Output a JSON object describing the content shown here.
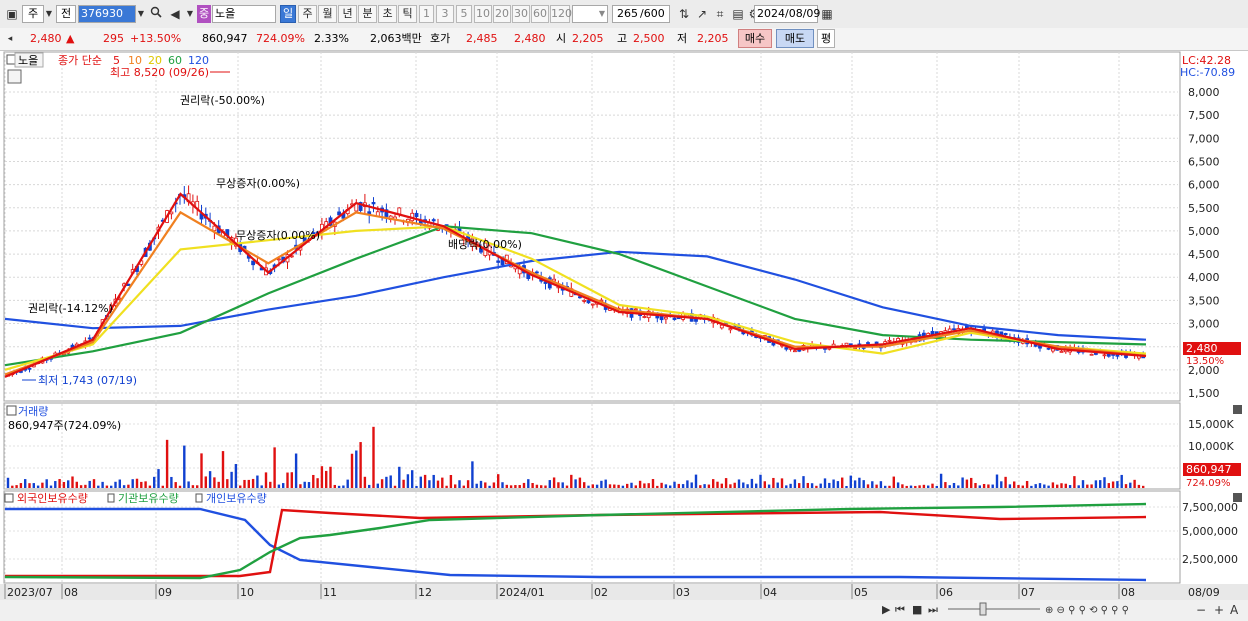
{
  "toolbar": {
    "type_label": "주",
    "period_label": "전",
    "code": "376930",
    "badge": "중",
    "name": "노을",
    "periods": [
      "일",
      "주",
      "월",
      "년",
      "분",
      "초",
      "틱"
    ],
    "ticks": [
      "1",
      "3",
      "5",
      "10",
      "20",
      "30",
      "60",
      "120"
    ],
    "count": "265",
    "count_total": "/600",
    "date": "2024/08/09"
  },
  "quote": {
    "price": "2,480",
    "arrow": "▲",
    "change": "295",
    "change_pct": "+13.50%",
    "volume": "860,947",
    "volume_pct": "724.09%",
    "turnover": "2.33%",
    "amount": "2,063백만",
    "hoga_label": "호가",
    "ask": "2,485",
    "bid": "2,480",
    "open_label": "시",
    "open": "2,205",
    "high_label": "고",
    "high": "2,500",
    "low_label": "저",
    "low": "2,205",
    "buy_label": "매수",
    "sell_label": "매도",
    "eval_label": "평"
  },
  "price_panel": {
    "name_tag": "노을",
    "ma_label": "종가 단순",
    "ma_periods": [
      "5",
      "10",
      "20",
      "60",
      "120"
    ],
    "lc": "LC:42.28",
    "hc": "HC:-70.89",
    "y_ticks": [
      "8,000",
      "7,500",
      "7,000",
      "6,500",
      "6,000",
      "5,500",
      "5,000",
      "4,500",
      "4,000",
      "3,500",
      "3,000",
      "2,500",
      "2,000",
      "1,500"
    ],
    "high_note": "최고 8,520 (09/26)",
    "low_note": "최저 1,743 (07/19)",
    "events": [
      "권리락(-14.12%)",
      "권리락(-50.00%)",
      "무상증자(0.00%)",
      "무상증자(0.00%)",
      "배당락(0.00%)"
    ],
    "last_price": "2,480",
    "last_pct": "13.50%"
  },
  "volume_panel": {
    "title": "거래량",
    "value": "860,947주(724.09%)",
    "y_ticks": [
      "15,000K",
      "10,000K",
      "5,000K"
    ],
    "last": "860,947",
    "last_pct": "724.09%"
  },
  "holdings_panel": {
    "series": [
      "외국인보유수량",
      "기관보유수량",
      "개인보유수량"
    ],
    "y_ticks": [
      "7,500,000",
      "5,000,000",
      "2,500,000"
    ]
  },
  "x_axis": [
    "2023/07",
    "08",
    "09",
    "10",
    "11",
    "12",
    "2024/01",
    "02",
    "03",
    "04",
    "05",
    "06",
    "07",
    "08",
    "08/09"
  ],
  "colors": {
    "ma5": "#e01010",
    "ma10": "#f08020",
    "ma20": "#f0e020",
    "ma60": "#20a040",
    "ma120": "#2050e0",
    "up": "#e01010",
    "down": "#1040d0"
  },
  "chart_data": {
    "type": "line",
    "x": [
      "2023/07",
      "08",
      "09",
      "10",
      "11",
      "12",
      "2024/01",
      "02",
      "03",
      "04",
      "05",
      "06",
      "07",
      "08"
    ],
    "series": [
      {
        "name": "5",
        "values": [
          1850,
          2650,
          5800,
          4100,
          5600,
          5100,
          4050,
          3250,
          3100,
          2450,
          2550,
          2900,
          2450,
          2300
        ]
      },
      {
        "name": "10",
        "values": [
          1900,
          2600,
          5400,
          4300,
          5400,
          5050,
          4100,
          3300,
          3100,
          2500,
          2500,
          2850,
          2500,
          2300
        ]
      },
      {
        "name": "20",
        "values": [
          2000,
          2550,
          4600,
          4800,
          5000,
          5100,
          4400,
          3400,
          3150,
          2600,
          2350,
          2800,
          2500,
          2350
        ]
      },
      {
        "name": "60",
        "values": [
          2100,
          2400,
          2800,
          3650,
          4400,
          5100,
          4950,
          4500,
          3800,
          3100,
          2750,
          2650,
          2600,
          2550
        ]
      },
      {
        "name": "120",
        "values": [
          3100,
          2900,
          2950,
          3300,
          3600,
          4000,
          4350,
          4550,
          4450,
          3950,
          3350,
          2950,
          2750,
          2650
        ]
      }
    ],
    "ylim": [
      1500,
      8200
    ]
  }
}
